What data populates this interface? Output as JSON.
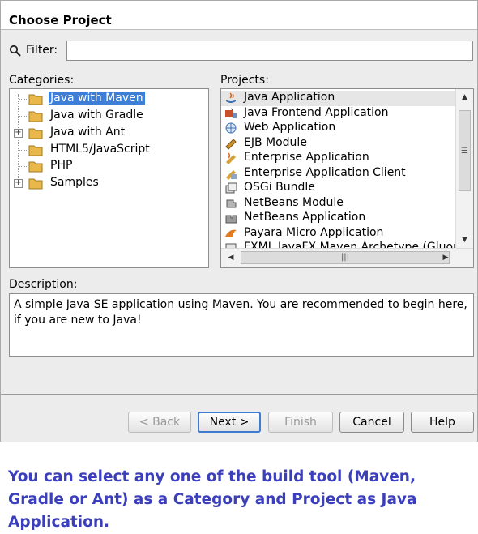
{
  "header": {
    "title": "Choose Project"
  },
  "filter": {
    "label": "Filter:",
    "value": ""
  },
  "categories": {
    "label": "Categories:",
    "items": [
      {
        "label": "Java with Maven",
        "selected": true,
        "expandable": false
      },
      {
        "label": "Java with Gradle",
        "selected": false,
        "expandable": false
      },
      {
        "label": "Java with Ant",
        "selected": false,
        "expandable": true
      },
      {
        "label": "HTML5/JavaScript",
        "selected": false,
        "expandable": false
      },
      {
        "label": "PHP",
        "selected": false,
        "expandable": false
      },
      {
        "label": "Samples",
        "selected": false,
        "expandable": true
      }
    ]
  },
  "projects": {
    "label": "Projects:",
    "items": [
      {
        "label": "Java Application",
        "icon": "java-app-icon",
        "selected": true
      },
      {
        "label": "Java Frontend Application",
        "icon": "frontend-app-icon",
        "selected": false
      },
      {
        "label": "Web Application",
        "icon": "web-app-icon",
        "selected": false
      },
      {
        "label": "EJB Module",
        "icon": "ejb-module-icon",
        "selected": false
      },
      {
        "label": "Enterprise Application",
        "icon": "enterprise-app-icon",
        "selected": false
      },
      {
        "label": "Enterprise Application Client",
        "icon": "enterprise-client-icon",
        "selected": false
      },
      {
        "label": "OSGi Bundle",
        "icon": "osgi-bundle-icon",
        "selected": false
      },
      {
        "label": "NetBeans Module",
        "icon": "netbeans-module-icon",
        "selected": false
      },
      {
        "label": "NetBeans Application",
        "icon": "netbeans-app-icon",
        "selected": false
      },
      {
        "label": "Payara Micro Application",
        "icon": "payara-icon",
        "selected": false
      },
      {
        "label": "FXML JavaFX Maven Archetype (Gluon)",
        "icon": "fxml-icon",
        "selected": false
      }
    ]
  },
  "description": {
    "label": "Description:",
    "text": "A simple Java SE application using Maven. You are recommended to begin here, if you are new to Java!"
  },
  "buttons": {
    "back": "< Back",
    "next": "Next >",
    "finish": "Finish",
    "cancel": "Cancel",
    "help": "Help"
  },
  "caption": "You can select any one of the build tool (Maven, Gradle or Ant) as a Category and Project as Java Application.",
  "colors": {
    "selection": "#3d7fd6",
    "caption": "#3b3fbb",
    "folder": "#e8b84a"
  }
}
